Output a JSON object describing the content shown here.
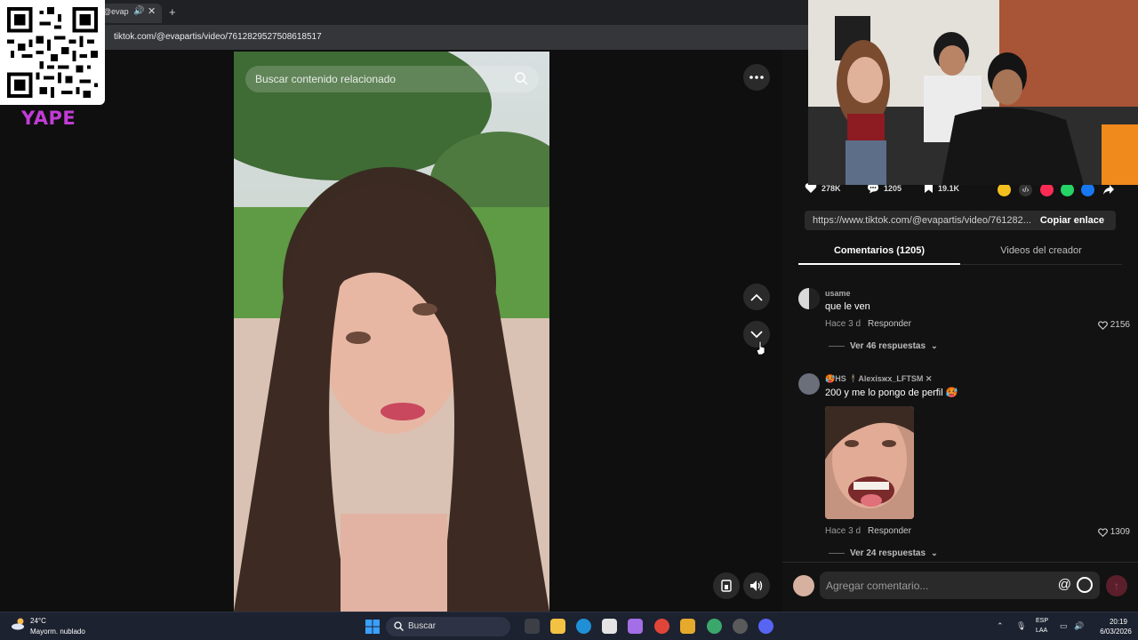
{
  "browser": {
    "tab_title": "@evap",
    "url": "tiktok.com/@evapartis/video/7612829527508618517"
  },
  "overlay": {
    "brand_label": "YAPE"
  },
  "video": {
    "search_placeholder": "Buscar contenido relacionado"
  },
  "stats": {
    "likes": "278K",
    "comments": "1205",
    "saves": "19.1K"
  },
  "share": {
    "link": "https://www.tiktok.com/@evapartis/video/761282...",
    "copy_label": "Copiar enlace"
  },
  "tabs": {
    "comments": "Comentarios (1205)",
    "creator_videos": "Videos del creador"
  },
  "comments": [
    {
      "user": "usame",
      "text": "que le ven",
      "time": "Hace 3 d",
      "reply": "Responder",
      "likes": "2156",
      "replies": "Ver 46 respuestas"
    },
    {
      "user": "🥵HS 🕴Alexisжx_LFTSM ✕",
      "text": "200 y me lo pongo de perfil 🥵",
      "time": "Hace 3 d",
      "reply": "Responder",
      "likes": "1309",
      "replies": "Ver 24 respuestas"
    }
  ],
  "composer": {
    "placeholder": "Agregar comentario..."
  },
  "taskbar": {
    "temperature": "24°C",
    "weather": "Mayorm. nublado",
    "search_label": "Buscar",
    "lang_top": "ESP",
    "lang_bottom": "LAA",
    "time": "20:19",
    "date": "6/03/2026"
  },
  "colors": {
    "accent_red": "#fe2c55",
    "yape_purple": "#c13cd6"
  }
}
